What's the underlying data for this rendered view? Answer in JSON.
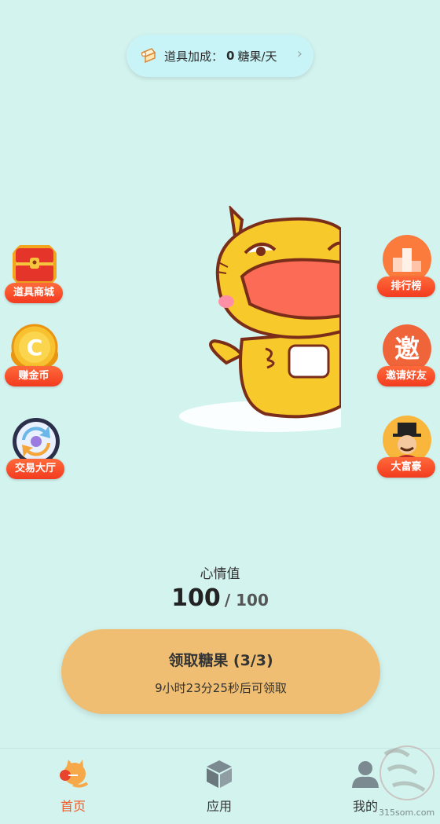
{
  "boost": {
    "prefix": "道具加成：",
    "value": "0",
    "unit": "糖果/天"
  },
  "left_buttons": [
    {
      "label": "道具商城",
      "icon": "treasure-chest-icon"
    },
    {
      "label": "赚金币",
      "icon": "gold-coin-icon"
    },
    {
      "label": "交易大厅",
      "icon": "exchange-icon"
    }
  ],
  "right_buttons": [
    {
      "label": "排行榜",
      "icon": "podium-icon"
    },
    {
      "label": "邀请好友",
      "icon": "invite-icon",
      "glyph": "邀"
    },
    {
      "label": "大富豪",
      "icon": "tycoon-icon"
    }
  ],
  "mood": {
    "label": "心情值",
    "current": "100",
    "separator": "/ 100"
  },
  "claim": {
    "title": "领取糖果 (3/3)",
    "subtitle": "9小时23分25秒后可领取"
  },
  "nav": [
    {
      "label": "首页",
      "icon": "home-cat-icon",
      "active": true
    },
    {
      "label": "应用",
      "icon": "cube-icon",
      "active": false
    },
    {
      "label": "我的",
      "icon": "user-icon",
      "active": false
    }
  ],
  "watermark": {
    "text": "315som.com"
  },
  "colors": {
    "background": "#d3f3ef",
    "accent": "#f05a28",
    "claim": "#efbe72"
  }
}
